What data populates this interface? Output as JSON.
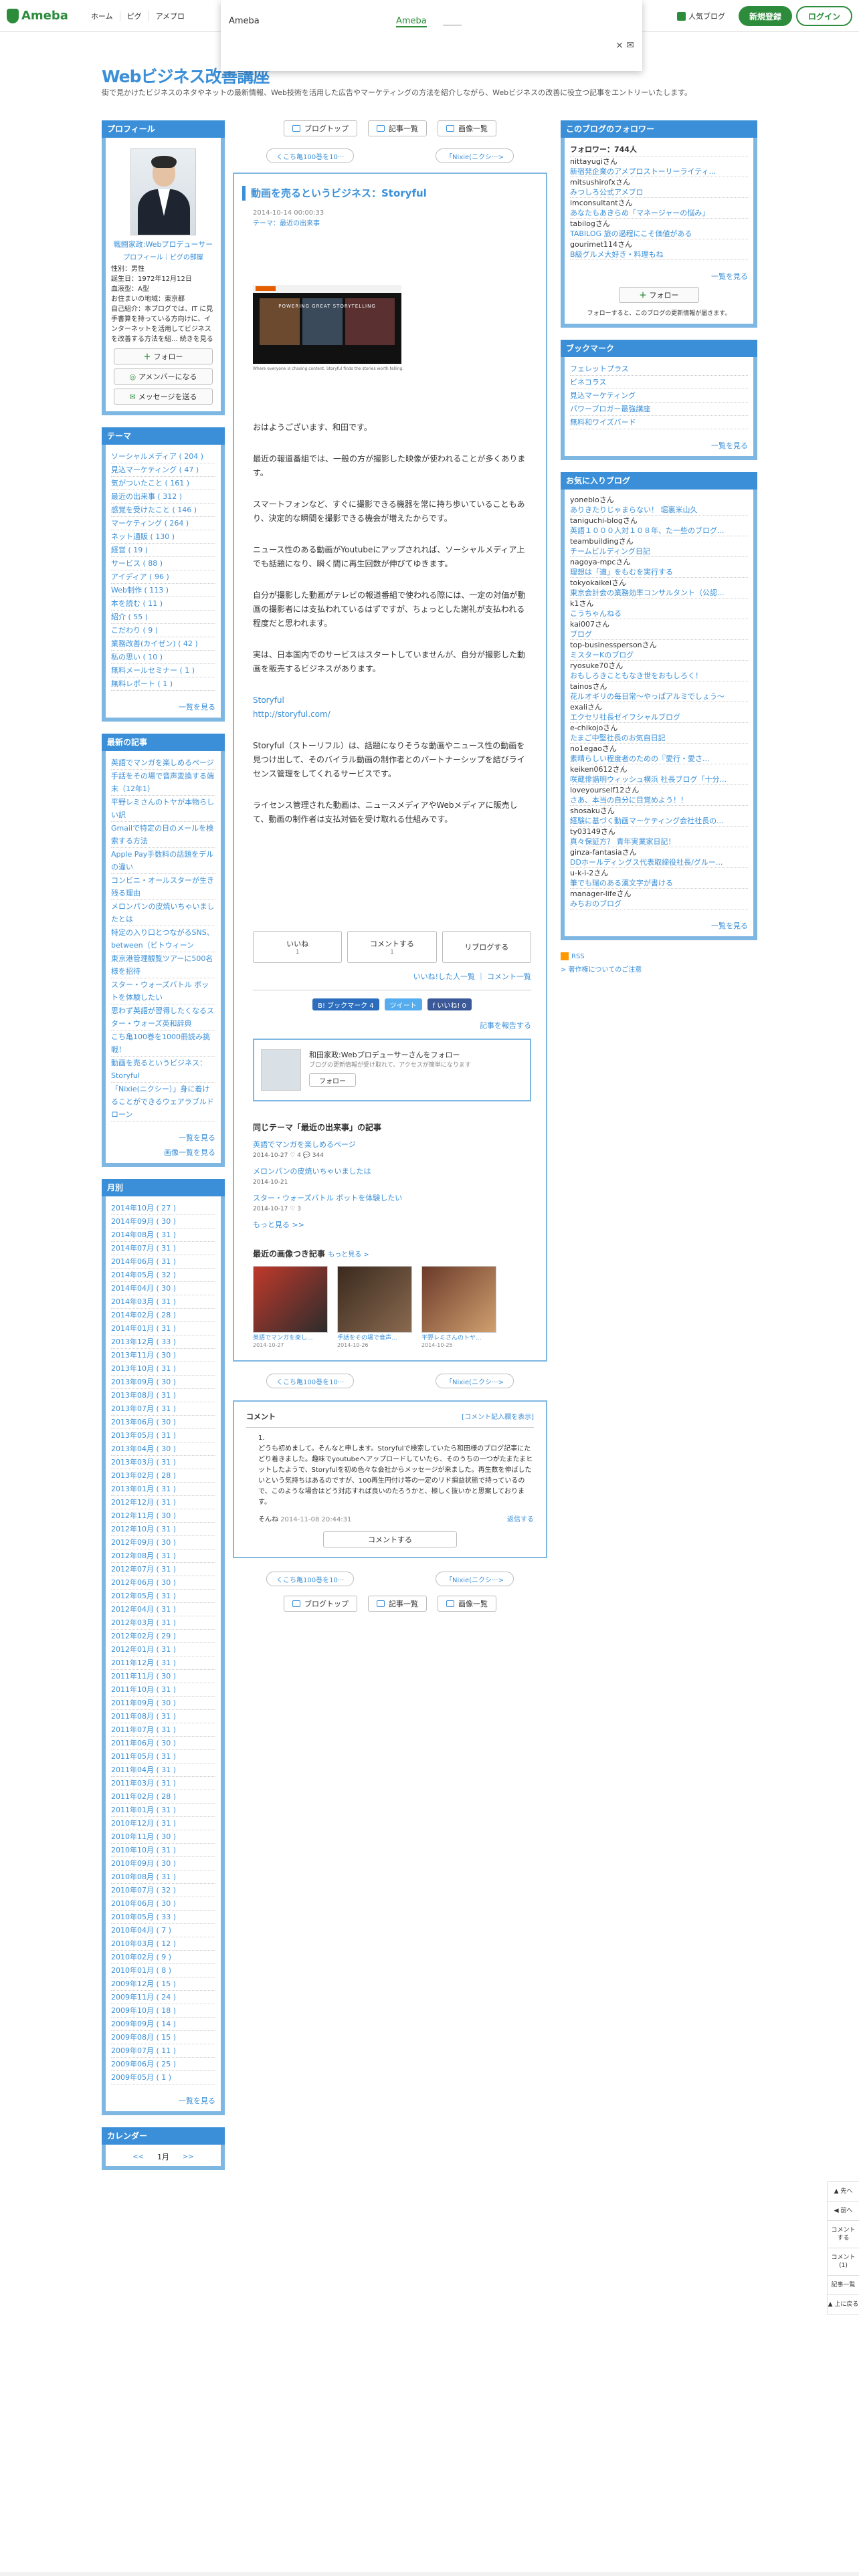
{
  "topbar": {
    "logo_text": "Ameba",
    "nav": [
      "ホーム",
      "ピグ",
      "アメプロ"
    ],
    "popular": "人気ブログ",
    "signup": "新規登録",
    "login": "ログイン"
  },
  "ameba_popup": {
    "title": "Ameba",
    "link": "Ameba",
    "close": "× ✉"
  },
  "blog": {
    "title": "Webビジネス改善講座",
    "desc": "街で見かけたビジネスのネタやネットの最新情報、Web技術を活用した広告やマーケティングの方法を紹介しながら、Webビジネスの改善に役立つ記事をエントリーいたします。"
  },
  "profile": {
    "header": "プロフィール",
    "name": "戦闘家政:Webプロデューサー",
    "links": "プロフィール｜ピグの部屋",
    "info": [
      "性別：男性",
      "誕生日：1972年12月12日",
      "血液型：A型",
      "お住まいの地域：東京都",
      "自己紹介：本ブログでは、IT に見手書算を持っている方向けに、インターネットを活用してビジネスを改善する方法を紹... 続きを見る"
    ],
    "follow": "フォロー",
    "amember": "アメンバーになる",
    "message": "メッセージを送る"
  },
  "themes": {
    "header": "テーマ",
    "items": [
      "ソーシャルメディア ( 204 )",
      "見込マーケティング ( 47 )",
      "気がついたこと ( 161 )",
      "最近の出来事 ( 312 )",
      "感覚を受けたこと ( 146 )",
      "マーケティング ( 264 )",
      "ネット通販 ( 130 )",
      "経営 ( 19 )",
      "サービス ( 88 )",
      "アイディア ( 96 )",
      "Web制作 ( 113 )",
      "本を読む ( 11 )",
      "紹介 ( 55 )",
      "こだわり ( 9 )",
      "業務改善(カイゼン) ( 42 )",
      "私の思い ( 10 )",
      "無料メールセミナー ( 1 )",
      "無料レポート ( 1 )"
    ],
    "more": "一覧を見る"
  },
  "recent": {
    "header": "最新の記事",
    "items": [
      "英語でマンガを楽しめるページ",
      "手話をその場で音声変換する端末（12年1）",
      "平野レミさんのトヤが本物らしい訳",
      "Gmailで特定の日のメールを検索する方法",
      "Apple Pay手数料の話題をデルの違い",
      "コンビニ・オールスターが生き残る理由",
      "メロンパンの皮焼いちゃいましたとは",
      "特定の入り口とつながるSNS、between（ビトウィーン",
      "東京港管理観覧ツアーに500名様を招待",
      "スター・ウォーズバトル ボットを体験したい",
      "思わず英語が習得したくなるスター・ウォーズ英和辞典",
      "こち亀100巻を1000冊読み挑戦！",
      "動画を売るというビジネス：Storyful",
      "「Nixie(ニクシー）」身に着けることができるウェアラブルドローン"
    ],
    "more": "一覧を見る",
    "more2": "画像一覧を見る"
  },
  "months": {
    "header": "月別",
    "items": [
      "2014年10月 ( 27 )",
      "2014年09月 ( 30 )",
      "2014年08月 ( 31 )",
      "2014年07月 ( 31 )",
      "2014年06月 ( 31 )",
      "2014年05月 ( 32 )",
      "2014年04月 ( 30 )",
      "2014年03月 ( 31 )",
      "2014年02月 ( 28 )",
      "2014年01月 ( 31 )",
      "2013年12月 ( 33 )",
      "2013年11月 ( 30 )",
      "2013年10月 ( 31 )",
      "2013年09月 ( 30 )",
      "2013年08月 ( 31 )",
      "2013年07月 ( 31 )",
      "2013年06月 ( 30 )",
      "2013年05月 ( 31 )",
      "2013年04月 ( 30 )",
      "2013年03月 ( 31 )",
      "2013年02月 ( 28 )",
      "2013年01月 ( 31 )",
      "2012年12月 ( 31 )",
      "2012年11月 ( 30 )",
      "2012年10月 ( 31 )",
      "2012年09月 ( 30 )",
      "2012年08月 ( 31 )",
      "2012年07月 ( 31 )",
      "2012年06月 ( 30 )",
      "2012年05月 ( 31 )",
      "2012年04月 ( 31 )",
      "2012年03月 ( 31 )",
      "2012年02月 ( 29 )",
      "2012年01月 ( 31 )",
      "2011年12月 ( 31 )",
      "2011年11月 ( 30 )",
      "2011年10月 ( 31 )",
      "2011年09月 ( 30 )",
      "2011年08月 ( 31 )",
      "2011年07月 ( 31 )",
      "2011年06月 ( 30 )",
      "2011年05月 ( 31 )",
      "2011年04月 ( 31 )",
      "2011年03月 ( 31 )",
      "2011年02月 ( 28 )",
      "2011年01月 ( 31 )",
      "2010年12月 ( 31 )",
      "2010年11月 ( 30 )",
      "2010年10月 ( 31 )",
      "2010年09月 ( 30 )",
      "2010年08月 ( 31 )",
      "2010年07月 ( 32 )",
      "2010年06月 ( 30 )",
      "2010年05月 ( 33 )",
      "2010年04月 ( 7 )",
      "2010年03月 ( 12 )",
      "2010年02月 ( 9 )",
      "2010年01月 ( 8 )",
      "2009年12月 ( 15 )",
      "2009年11月 ( 24 )",
      "2009年10月 ( 18 )",
      "2009年09月 ( 14 )",
      "2009年08月 ( 15 )",
      "2009年07月 ( 11 )",
      "2009年06月 ( 25 )",
      "2009年05月 ( 1 )"
    ],
    "more": "一覧を見る"
  },
  "calendar": {
    "header": "カレンダー",
    "prev": "<<",
    "month": "1月",
    "next": ">>"
  },
  "main": {
    "nav": [
      "ブログトップ",
      "記事一覧",
      "画像一覧"
    ],
    "prev": "くこち亀100巻を10···",
    "next": "「Nixie(ニクシ···>",
    "article": {
      "title": "動画を売るというビジネス：Storyful",
      "date": "2014-10-14 00:00:33",
      "theme": "テーマ：最近の出来事",
      "thumb_caption": "POWERING GREAT STORYTELLING",
      "thumb_sub": "Where everyone is chasing content. Storyful finds the stories worth telling.",
      "paragraphs": [
        "おはようございます、和田です。",
        "最近の報道番組では、一般の方が撮影した映像が使われることが多くあります。",
        "スマートフォンなど、すぐに撮影できる機器を常に持ち歩いていることもあり、決定的な瞬間を撮影できる機会が増えたからです。",
        "ニュース性のある動画がYoutubeにアップされれば、ソーシャルメディア上でも話題になり、瞬く間に再生回数が伸びてゆきます。",
        "自分が撮影した動画がテレビの報道番組で使われる際には、一定の対価が動画の撮影者には支払われているはずですが、ちょっとした謝礼が支払われる程度だと思われます。",
        "実は、日本国内でのサービスはスタートしていませんが、自分が撮影した動画を販売するビジネスがあります。",
        "Storyful",
        "http://storyful.com/",
        "Storyful（ストーリフル）は、話題になりそうな動画やニュース性の動画を見つけ出して、そのバイラル動画の制作者とのパートナーシップを結びライセンス管理をしてくれるサービスです。",
        "ライセンス管理された動画は、ニュースメディアやWebメディアに販売して、動画の制作者は支払対価を受け取れる仕組みです。"
      ],
      "react": [
        {
          "label": "いいね",
          "count": "1"
        },
        {
          "label": "コメントする",
          "count": "1"
        },
        {
          "label": "リブログする",
          "count": ""
        }
      ],
      "sublinks": "いいね!した人一覧 ｜ コメント一覧",
      "share": [
        "B! ブックマーク 4",
        "ツイート",
        "f いいね! 0"
      ],
      "sharelink": "記事を報告する"
    },
    "follow": {
      "text": "和田家政:Webプロデューサーさんをフォロー",
      "sub": "ブログの更新情報が受け取れて、アクセスが簡単になります",
      "button": "フォロー"
    },
    "related_title": "同じテーマ「最近の出来事」の記事",
    "related": [
      {
        "title": "英語でマンガを楽しめるページ",
        "date": "2014-10-27  ♡ 4  💬 344"
      },
      {
        "title": "メロンパンの皮焼いちゃいましたは",
        "date": "2014-10-21"
      },
      {
        "title": "スター・ウォーズバトル ボットを体験したい",
        "date": "2014-10-17  ♡ 3"
      }
    ],
    "related_more": "もっと見る >>",
    "images_title": "最近の画像つき記事",
    "images_more": "もっと見る >",
    "images": [
      {
        "title": "英語でマンガを楽し...",
        "date": "2014-10-27"
      },
      {
        "title": "手話をその場で音声...",
        "date": "2014-10-26"
      },
      {
        "title": "平野レミさんのトヤ...",
        "date": "2014-10-25"
      }
    ],
    "comments": {
      "title": "コメント",
      "write": "[コメント記入欄を表示]",
      "num": "1.",
      "body": "どうも初めまして。そんなと申します。Storyfulで検索していたら和田様のブログ記事にたどり着きました。趣味でyoutubeへアップロードしていたら、そのうちの一つがたまたまヒットしたようで、Storyfulを初め色々な会社からメッセージが来ました。再生数を伸ばしたいという気持ちはあるのですが、100再生円付け等の一定のリド損益状態で持っているので、このような場合はどう対応すれば良いのたろうかと、極しく抜いかと思案しております。",
      "author": "そんね",
      "date": "2014-11-08 20:44:31",
      "reply": "返信する",
      "button": "コメントする"
    }
  },
  "right": {
    "followers": {
      "header": "このブログのフォロワー",
      "count": "フォロワー：744人",
      "items": [
        {
          "name": "nittayugiさん",
          "blog": "新宿発企業のアメプロストーリーライティ..."
        },
        {
          "name": "mitsushirofxさん",
          "blog": "みつしろ公式アメブロ"
        },
        {
          "name": "imconsultantさん",
          "blog": "あなたもあきらめ「マネージャーの悩み」"
        },
        {
          "name": "tabilogさん",
          "blog": "TABILOG 旅の過程にこそ価値がある"
        },
        {
          "name": "gourimet114さん",
          "blog": "B級グルメ大好き・料理もね"
        }
      ],
      "more": "一覧を見る",
      "follow": "フォロー",
      "note": "フォローすると、このブログの更新情報が届きます。"
    },
    "bookmarks": {
      "header": "ブックマーク",
      "items": [
        "フェレットプラス",
        "ビネコラス",
        "見込マーケティング",
        "パワーブロガー最強講座",
        "無料和ワイズバード"
      ],
      "more": "一覧を見る"
    },
    "favorites": {
      "header": "お気に入りブログ",
      "items": [
        {
          "name": "yonebloさん",
          "blog": "ありきたりじゃまらない！ 堀裏米山久"
        },
        {
          "name": "taniguchi-blogさん",
          "blog": "英語１０００人対１０８年、た一些のブログ..."
        },
        {
          "name": "teambuildingさん",
          "blog": "チームビルディング日記"
        },
        {
          "name": "nagoya-mpcさん",
          "blog": "理想は「適」をもむを実行する"
        },
        {
          "name": "tokyokaikeiさん",
          "blog": "東京会計会の業務効率コンサルタント（公認..."
        },
        {
          "name": "k1さん",
          "blog": "こうちゃんねる"
        },
        {
          "name": "kai007さん",
          "blog": "ブログ"
        },
        {
          "name": "top-businesspersonさん",
          "blog": "ミスターKのブログ"
        },
        {
          "name": "ryosuke70さん",
          "blog": "おもしろきこともなき世をおもしろく！"
        },
        {
          "name": "tainosさん",
          "blog": "花ルオギリの毎日常～やっぱアルミでしょう～"
        },
        {
          "name": "exaliさん",
          "blog": "エクセリ社長ゼイフシャルブログ"
        },
        {
          "name": "e-chikojoさん",
          "blog": "たまご中堅社長のお気自日記"
        },
        {
          "name": "no1egaoさん",
          "blog": "素晴らしい程度者のための『愛行・愛さ..."
        },
        {
          "name": "keiken0612さん",
          "blog": "咲蔵俳諧明ウィッシュ横浜 社長ブログ「十分..."
        },
        {
          "name": "loveyourself12さん",
          "blog": "さあ、本当の自分に目覚めよう！！"
        },
        {
          "name": "shosakuさん",
          "blog": "経験に基づく動画マーケティング会社社長の..."
        },
        {
          "name": "ty03149さん",
          "blog": "真々保証方？ 青年実業家日記！"
        },
        {
          "name": "ginza-fantasiaさん",
          "blog": "DDホールディングス代表取締役社長/グルー..."
        },
        {
          "name": "u-k-i-2さん",
          "blog": "筆でも瑞のある漢文字が書ける"
        },
        {
          "name": "manager-lifeさん",
          "blog": "みちおのブログ"
        }
      ],
      "more": "一覧を見る"
    },
    "rss": "RSS",
    "rss_note": "> 著作権についてのご注意"
  },
  "sidetools": [
    "▲ 先へ",
    "◀ 前へ",
    "コメント する",
    "コメント (1)",
    "記事一覧",
    "▲ 上に戻る"
  ]
}
